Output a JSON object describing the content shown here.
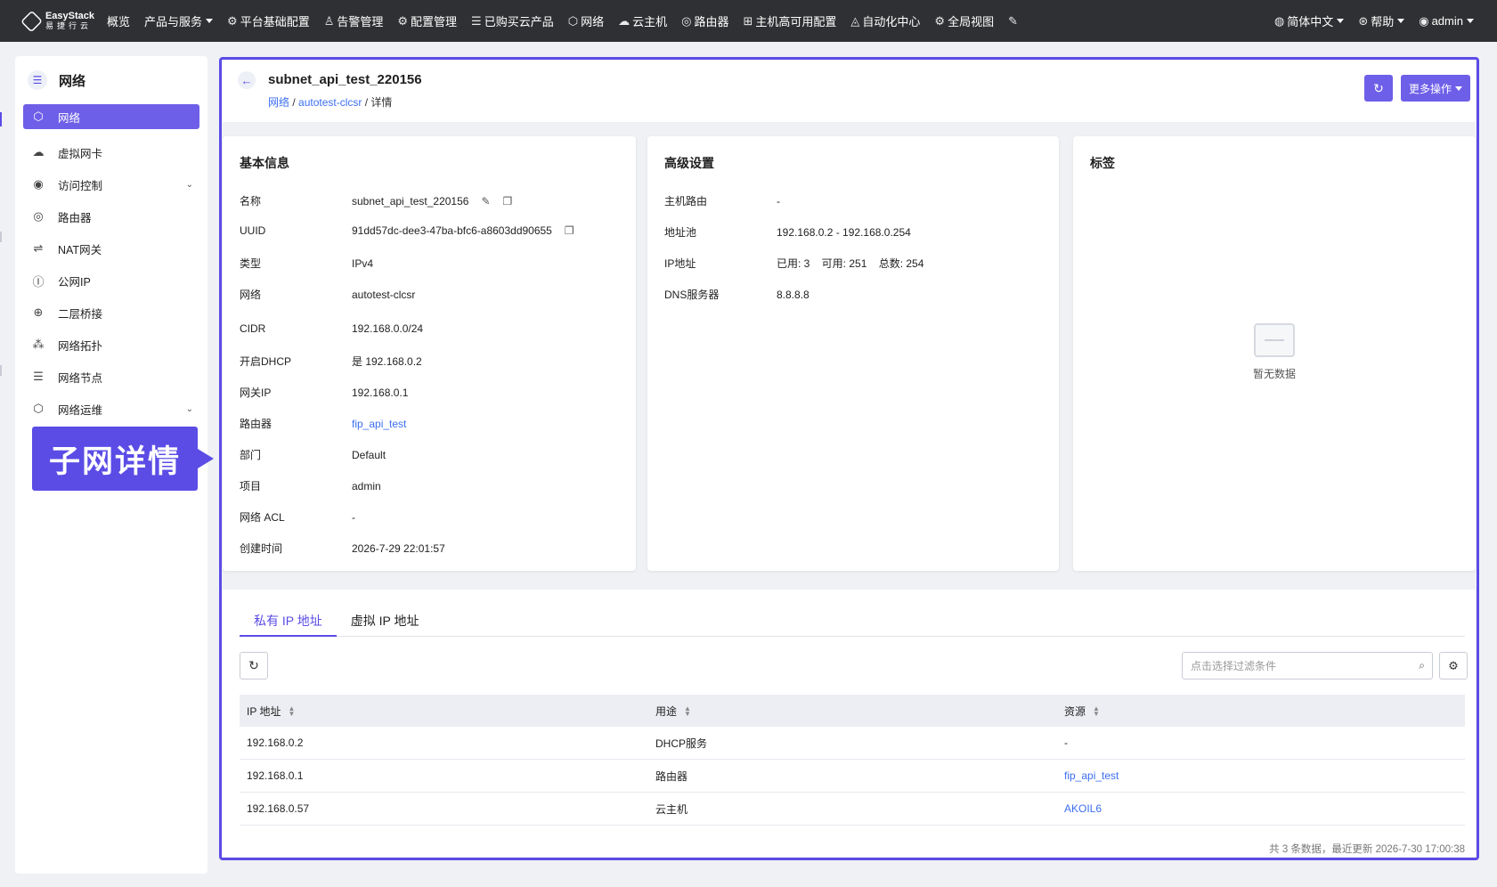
{
  "topbar": {
    "logo": {
      "name": "EasyStack",
      "sub": "易捷行云"
    },
    "nav": [
      {
        "label": "概览",
        "icon": ""
      },
      {
        "label": "产品与服务",
        "icon": "",
        "dropdown": true
      },
      {
        "label": "平台基础配置",
        "icon": "⚙"
      },
      {
        "label": "告警管理",
        "icon": "♙"
      },
      {
        "label": "配置管理",
        "icon": "⚙"
      },
      {
        "label": "已购买云产品",
        "icon": "☰"
      },
      {
        "label": "网络",
        "icon": "⬡"
      },
      {
        "label": "云主机",
        "icon": "☁"
      },
      {
        "label": "路由器",
        "icon": "◎"
      },
      {
        "label": "主机高可用配置",
        "icon": "⊞"
      },
      {
        "label": "自动化中心",
        "icon": "◬"
      },
      {
        "label": "全局视图",
        "icon": "⚙"
      }
    ],
    "right": {
      "lang": "简体中文",
      "help": "帮助",
      "user": "admin"
    }
  },
  "sidebar": {
    "title": "网络",
    "items": [
      {
        "label": "网络",
        "icon": "⬡"
      },
      {
        "label": "虚拟网卡",
        "icon": "☁"
      },
      {
        "label": "访问控制",
        "icon": "◉"
      },
      {
        "label": "路由器",
        "icon": "◎"
      },
      {
        "label": "NAT网关",
        "icon": "⇌"
      },
      {
        "label": "公网IP",
        "icon": "Ⓘ"
      },
      {
        "label": "二层桥接",
        "icon": "⊕"
      },
      {
        "label": "网络拓扑",
        "icon": "⁂"
      },
      {
        "label": "网络节点",
        "icon": "☰"
      },
      {
        "label": "网络运维",
        "icon": "⬡"
      }
    ]
  },
  "callout": "子网详情",
  "header": {
    "title": "subnet_api_test_220156",
    "breadcrumb": [
      "网络",
      "autotest-clcsr",
      "详情"
    ],
    "more_label": "更多操作"
  },
  "basic": {
    "title": "基本信息",
    "rows": [
      {
        "k": "名称",
        "v": "subnet_api_test_220156"
      },
      {
        "k": "UUID",
        "v": "91dd57dc-dee3-47ba-bfc6-a8603dd90655"
      },
      {
        "k": "类型",
        "v": "IPv4"
      },
      {
        "k": "网络",
        "v": "autotest-clcsr"
      },
      {
        "k": "CIDR",
        "v": "192.168.0.0/24"
      },
      {
        "k": "开启DHCP",
        "v": "是  192.168.0.2"
      },
      {
        "k": "网关IP",
        "v": "192.168.0.1"
      },
      {
        "k": "路由器",
        "v": "fip_api_test"
      },
      {
        "k": "部门",
        "v": "Default"
      },
      {
        "k": "项目",
        "v": "admin"
      },
      {
        "k": "网络 ACL",
        "v": "-"
      },
      {
        "k": "创建时间",
        "v": "2026-7-29 22:01:57"
      }
    ]
  },
  "advanced": {
    "title": "高级设置",
    "rows": [
      {
        "k": "主机路由",
        "v": "-"
      },
      {
        "k": "地址池",
        "v": "192.168.0.2 - 192.168.0.254"
      },
      {
        "k": "IP地址",
        "v": "已用: 3    可用: 251    总数: 254"
      },
      {
        "k": "DNS服务器",
        "v": "8.8.8.8"
      }
    ]
  },
  "tags": {
    "title": "标签",
    "empty": "暂无数据"
  },
  "tabs": [
    "私有 IP 地址",
    "虚拟 IP 地址"
  ],
  "filter": {
    "placeholder": "点击选择过滤条件"
  },
  "table": {
    "headers": [
      "IP 地址",
      "用途",
      "资源"
    ],
    "rows": [
      [
        "192.168.0.2",
        "DHCP服务",
        "-"
      ],
      [
        "192.168.0.1",
        "路由器",
        "fip_api_test"
      ],
      [
        "192.168.0.57",
        "云主机",
        "AKOIL6"
      ]
    ]
  },
  "footer": "共 3 条数据，最近更新  2026-7-30 17:00:38"
}
